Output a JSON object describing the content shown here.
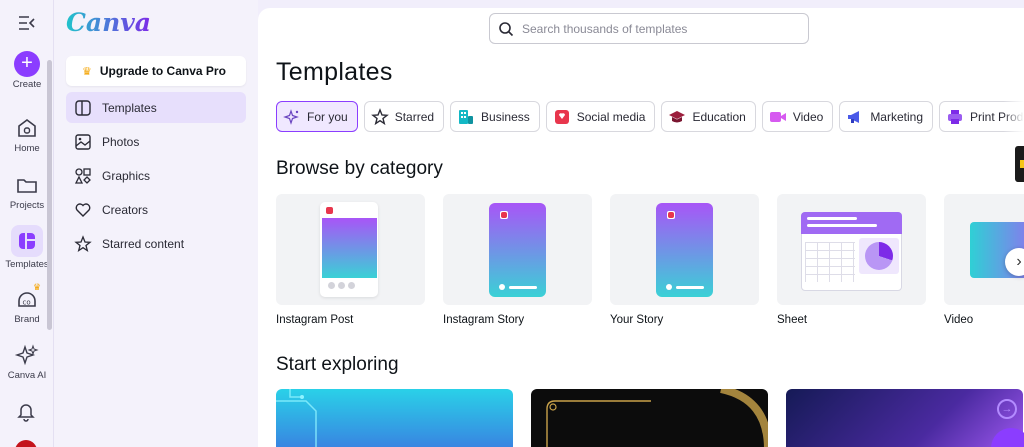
{
  "brand": {
    "logo_text": "Canva"
  },
  "rail": {
    "items": [
      {
        "label": "Create",
        "icon": "plus-icon"
      },
      {
        "label": "Home",
        "icon": "home-icon"
      },
      {
        "label": "Projects",
        "icon": "folder-icon"
      },
      {
        "label": "Templates",
        "icon": "templates-icon",
        "active": true
      },
      {
        "label": "Brand",
        "icon": "brand-icon"
      },
      {
        "label": "Canva AI",
        "icon": "sparkle-icon"
      }
    ]
  },
  "panel": {
    "upgrade_label": "Upgrade to Canva Pro",
    "menu": [
      {
        "label": "Templates",
        "icon": "templates-icon",
        "active": true
      },
      {
        "label": "Photos",
        "icon": "photo-icon"
      },
      {
        "label": "Graphics",
        "icon": "graphics-icon"
      },
      {
        "label": "Creators",
        "icon": "heart-icon"
      },
      {
        "label": "Starred content",
        "icon": "star-icon"
      }
    ]
  },
  "search": {
    "placeholder": "Search thousands of templates"
  },
  "main": {
    "title": "Templates",
    "chips": [
      {
        "label": "For you",
        "icon": "sparkle-icon",
        "active": true
      },
      {
        "label": "Starred",
        "icon": "star-icon"
      },
      {
        "label": "Business",
        "icon": "business-icon"
      },
      {
        "label": "Social media",
        "icon": "social-media-icon"
      },
      {
        "label": "Education",
        "icon": "graduation-cap-icon"
      },
      {
        "label": "Video",
        "icon": "video-icon"
      },
      {
        "label": "Marketing",
        "icon": "megaphone-icon"
      },
      {
        "label": "Print Products",
        "icon": "printer-icon"
      }
    ],
    "browse_heading": "Browse by category",
    "categories": [
      {
        "label": "Instagram Post"
      },
      {
        "label": "Instagram Story"
      },
      {
        "label": "Your Story"
      },
      {
        "label": "Sheet"
      },
      {
        "label": "Video"
      }
    ],
    "explore_heading": "Start exploring"
  },
  "colors": {
    "accent": "#8b3dff",
    "active_bg": "#e7dffc",
    "crown": "#f4a300"
  }
}
